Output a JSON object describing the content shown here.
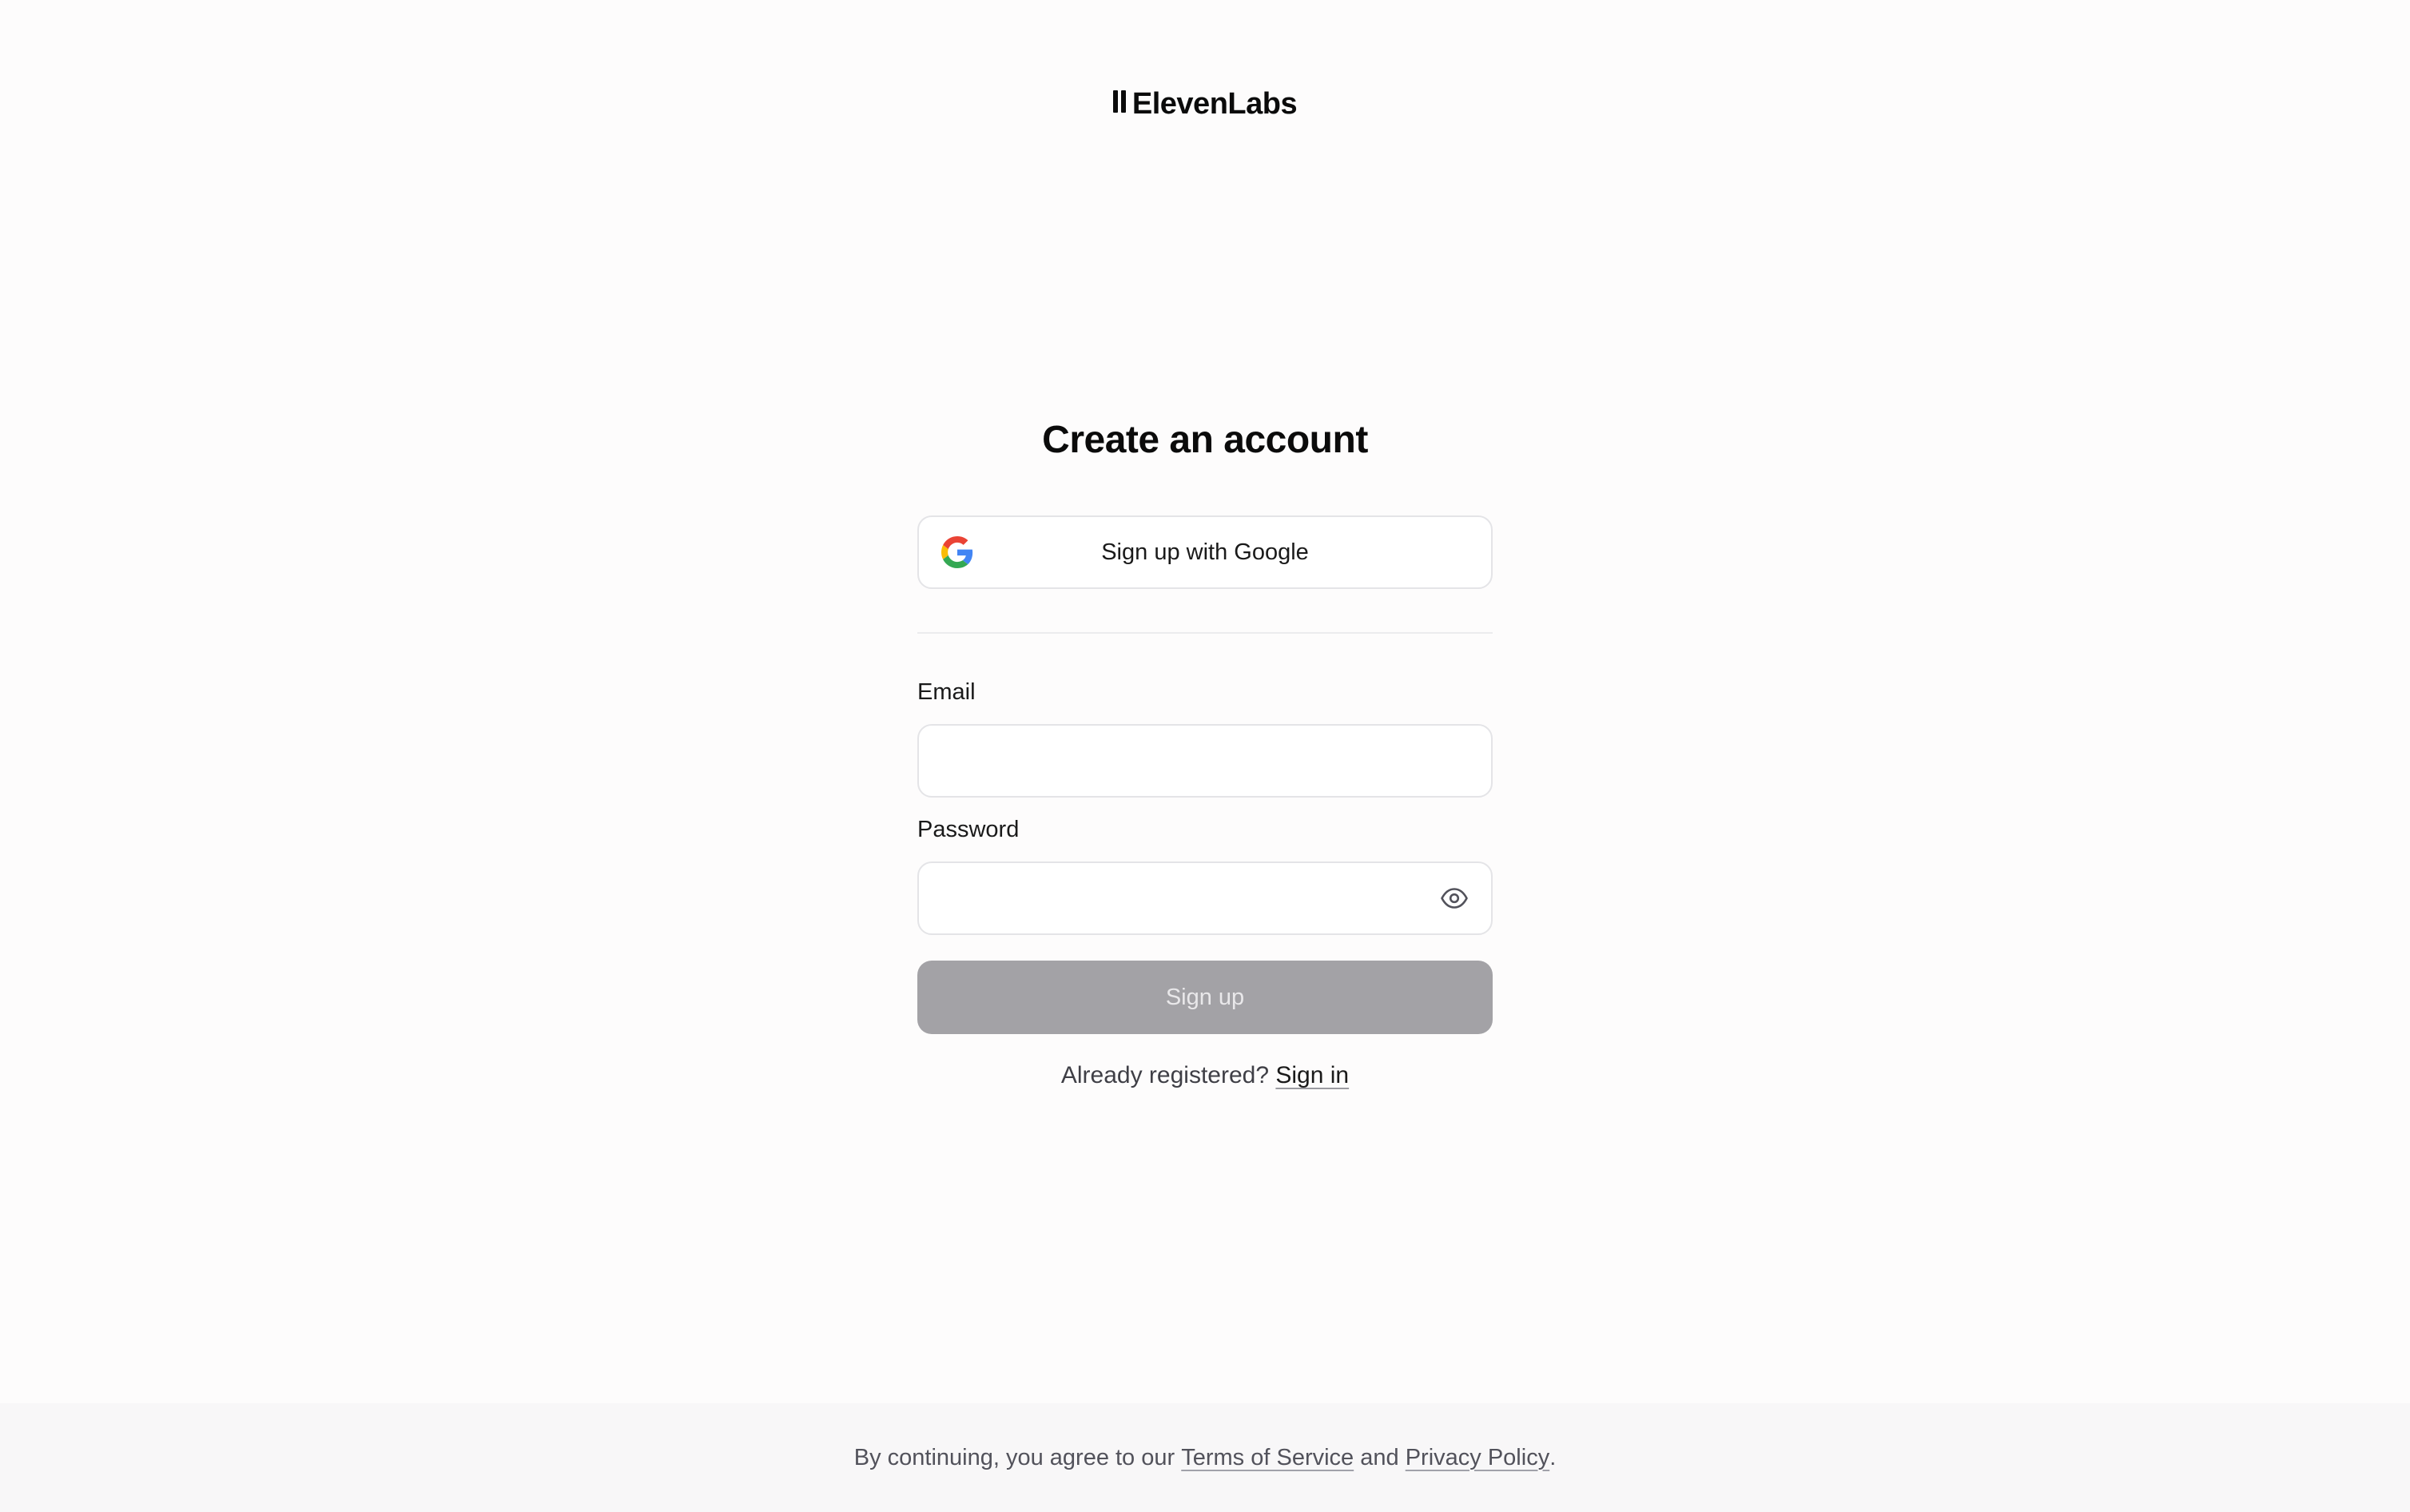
{
  "brand": {
    "logo_text": "ElevenLabs"
  },
  "page": {
    "title": "Create an account"
  },
  "google_button": {
    "label": "Sign up with Google",
    "icon": "google-icon"
  },
  "form": {
    "email": {
      "label": "Email",
      "value": "",
      "placeholder": ""
    },
    "password": {
      "label": "Password",
      "value": "",
      "placeholder": "",
      "toggle_icon": "eye-icon"
    },
    "submit_label": "Sign up",
    "submit_disabled_color": "#a3a2a6"
  },
  "signin": {
    "prompt": "Already registered?",
    "link_label": "Sign in"
  },
  "footer": {
    "prefix": "By continuing, you agree to our",
    "terms_label": "Terms of Service",
    "connector": "and",
    "privacy_label": "Privacy Policy",
    "suffix": "."
  }
}
